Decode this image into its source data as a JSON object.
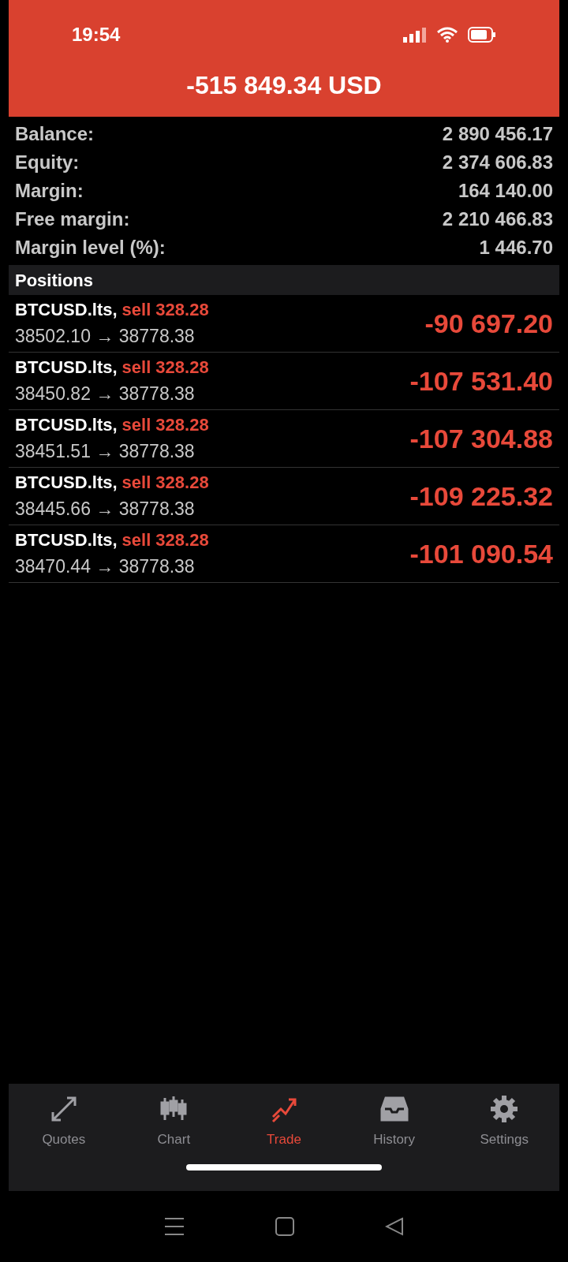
{
  "status_bar": {
    "time": "19:54"
  },
  "header": {
    "title": "-515 849.34 USD"
  },
  "summary": [
    {
      "label": "Balance:",
      "value": "2 890 456.17"
    },
    {
      "label": "Equity:",
      "value": "2 374 606.83"
    },
    {
      "label": "Margin:",
      "value": "164 140.00"
    },
    {
      "label": "Free margin:",
      "value": "2 210 466.83"
    },
    {
      "label": "Margin level (%):",
      "value": "1 446.70"
    }
  ],
  "positions": {
    "title": "Positions",
    "items": [
      {
        "symbol": "BTCUSD.lts,",
        "side": "sell 328.28",
        "prices": "38502.10 → 38778.38",
        "profit": "-90 697.20"
      },
      {
        "symbol": "BTCUSD.lts,",
        "side": "sell 328.28",
        "prices": "38450.82 → 38778.38",
        "profit": "-107 531.40"
      },
      {
        "symbol": "BTCUSD.lts,",
        "side": "sell 328.28",
        "prices": "38451.51 → 38778.38",
        "profit": "-107 304.88"
      },
      {
        "symbol": "BTCUSD.lts,",
        "side": "sell 328.28",
        "prices": "38445.66 → 38778.38",
        "profit": "-109 225.32"
      },
      {
        "symbol": "BTCUSD.lts,",
        "side": "sell 328.28",
        "prices": "38470.44 → 38778.38",
        "profit": "-101 090.54"
      }
    ]
  },
  "tabs": [
    {
      "label": "Quotes",
      "kind": "quotes",
      "selected": false
    },
    {
      "label": "Chart",
      "kind": "chart",
      "selected": false
    },
    {
      "label": "Trade",
      "kind": "trade",
      "selected": true
    },
    {
      "label": "History",
      "kind": "history",
      "selected": false
    },
    {
      "label": "Settings",
      "kind": "settings",
      "selected": false
    }
  ]
}
